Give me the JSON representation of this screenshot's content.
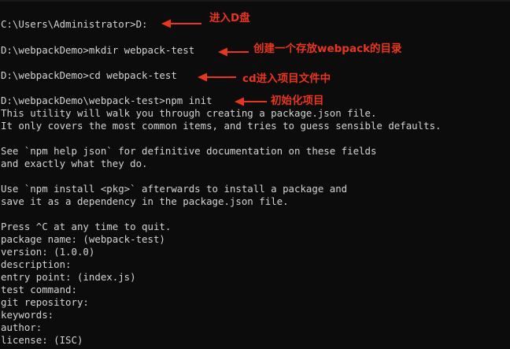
{
  "colors": {
    "background": "#0c0c0c",
    "terminal_text": "#d4d4d4",
    "annotation": "#e8361e"
  },
  "terminal": {
    "lines": [
      "C:\\Users\\Administrator>D:",
      "D:\\webpackDemo>mkdir webpack-test",
      "D:\\webpackDemo>cd webpack-test",
      "D:\\webpackDemo\\webpack-test>npm init",
      "This utility will walk you through creating a package.json file.",
      "It only covers the most common items, and tries to guess sensible defaults.",
      "See `npm help json` for definitive documentation on these fields",
      "and exactly what they do.",
      "Use `npm install <pkg>` afterwards to install a package and",
      "save it as a dependency in the package.json file.",
      "Press ^C at any time to quit.",
      "package name: (webpack-test)",
      "version: (1.0.0)",
      "description:",
      "entry point: (index.js)",
      "test command:",
      "git repository:",
      "keywords:",
      "author:",
      "license: (ISC)"
    ]
  },
  "annotations": [
    {
      "text": "进入D盘",
      "arrow_icon": "red-arrow-left"
    },
    {
      "text": "创建一个存放webpack的目录",
      "arrow_icon": "red-arrow-left"
    },
    {
      "text": "cd进入项目文件中",
      "arrow_icon": "red-arrow-left"
    },
    {
      "text": "初始化项目",
      "arrow_icon": "red-arrow-left"
    }
  ]
}
